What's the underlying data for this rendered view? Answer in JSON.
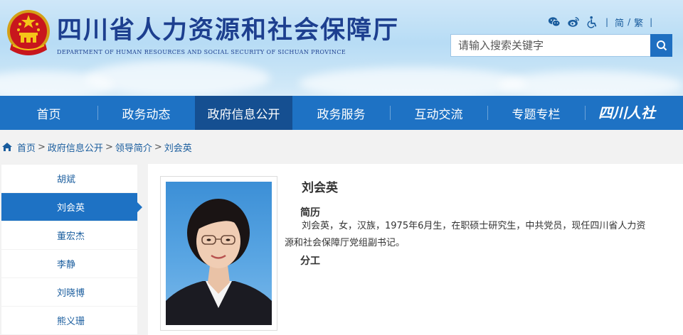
{
  "header": {
    "title": "四川省人力资源和社会保障厅",
    "subtitle": "DEPARTMENT OF HUMAN RESOURCES AND SOCIAL SECURITY OF SICHUAN PROVINCE",
    "lang_simplified": "简",
    "lang_sep": "/",
    "lang_traditional": "繁",
    "divider": "|"
  },
  "search": {
    "placeholder": "请输入搜索关键字"
  },
  "nav": {
    "items": [
      "首页",
      "政务动态",
      "政府信息公开",
      "政务服务",
      "互动交流",
      "专题专栏"
    ],
    "logo_text": "四川人社"
  },
  "breadcrumb": {
    "items": [
      "首页",
      "政府信息公开",
      "领导简介",
      "刘会英"
    ],
    "separator": ">"
  },
  "sidebar": {
    "items": [
      "胡斌",
      "刘会英",
      "董宏杰",
      "李静",
      "刘晓博",
      "熊义珊"
    ]
  },
  "profile": {
    "name": "刘会英",
    "bio_heading": "简历",
    "bio_text": "刘会英，女，汉族，1975年6月生，在职硕士研究生，中共党员，现任四川省人力资源和社会保障厅党组副书记。",
    "duty_heading": "分工"
  },
  "colors": {
    "nav_bg": "#1e72c4",
    "nav_active": "#154f91",
    "title": "#1d3f8f",
    "link": "#1a5d9e"
  }
}
